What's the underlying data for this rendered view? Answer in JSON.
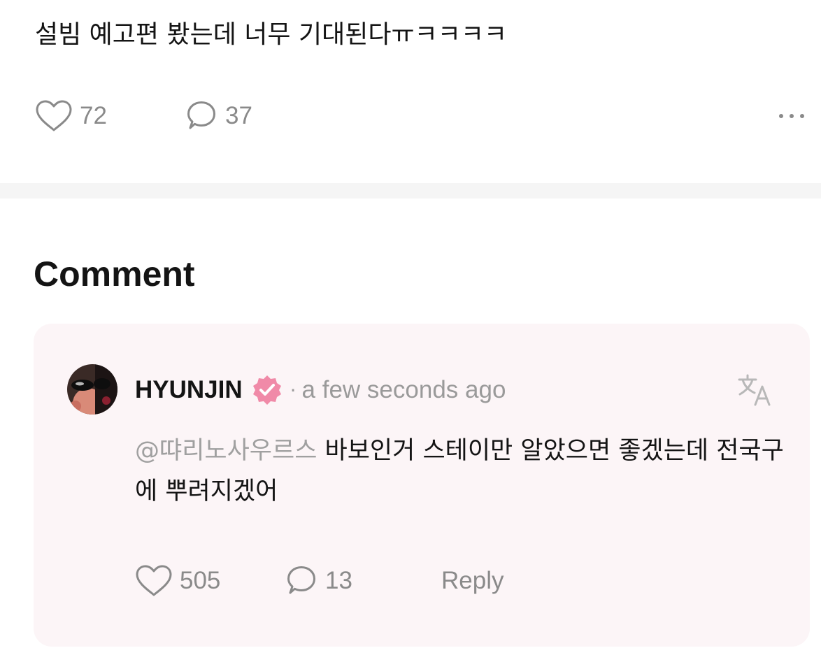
{
  "post": {
    "text": "설빔 예고편 봤는데 너무 기대된다ㅠㅋㅋㅋㅋ",
    "likes": "72",
    "comments": "37"
  },
  "comments_section": {
    "heading": "Comment"
  },
  "comment": {
    "author": "HYUNJIN",
    "separator": "·",
    "timestamp": "a few seconds ago",
    "mention": "@땨리노사우르스",
    "text": " 바보인거 스테이만 알았으면 좋겠는데 전국구에 뿌려지겠어",
    "likes": "505",
    "replies": "13",
    "reply_label": "Reply"
  },
  "colors": {
    "verified_badge": "#f08aa8",
    "card_background": "#fcf5f7",
    "muted_text": "#8a8a8a"
  },
  "icons": [
    "heart-icon",
    "comment-bubble-icon",
    "more-dots-icon",
    "verified-badge-icon",
    "translate-icon"
  ]
}
